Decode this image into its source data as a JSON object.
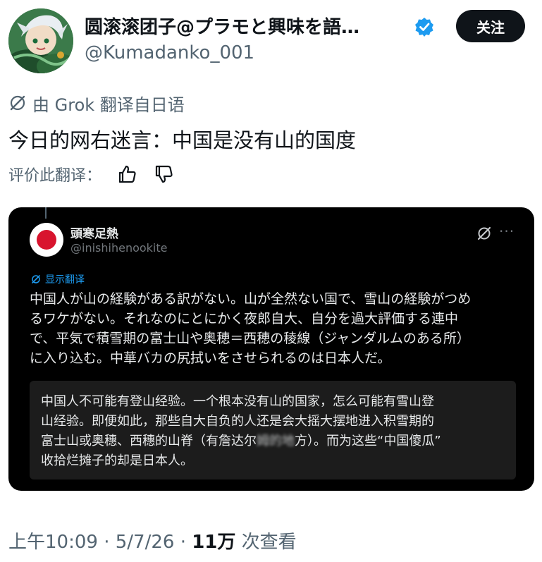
{
  "author": {
    "display_name": "圆滚滚团子@プラモと興味を語…",
    "handle": "@Kumadanko_001",
    "follow_label": "关注"
  },
  "translation": {
    "grok_label": "由 Grok 翻译自日语",
    "text": "今日的网右迷言：中国是没有山的国度",
    "rate_label": "评价此翻译："
  },
  "quote": {
    "name": "頭寒足熱",
    "handle": "@inishihenookite",
    "show_translation": "显示翻译",
    "more": "···",
    "original_lines": [
      "中国人が山の経験がある訳がない。山が全然ない国で、雪山の経験がつめ",
      "るワケがない。それなのにとにかく夜郎自大、自分を過大評価する連中",
      "で、平気で積雪期の富士山や奥穂＝西穂の稜線（ジャンダルムのある所）",
      "に入り込む。中華バカの尻拭いをさせられるのは日本人だ。"
    ],
    "translated_lines": [
      "中国人不可能有登山经验。一个根本没有山的国家，怎么可能有雪山登",
      "山经验。即便如此，那些自大自负的人还是会大摇大摆地进入积雪期的",
      "富士山或奥穗、西穗的山脊（有詹达尔",
      "方）。而为这些“中国傻瓜”",
      "收拾烂摊子的却是日本人。"
    ],
    "obscured_text": "姆的地"
  },
  "meta": {
    "time": "上午10:09",
    "date": "5/7/26",
    "views": "11万",
    "views_label": "次查看"
  }
}
